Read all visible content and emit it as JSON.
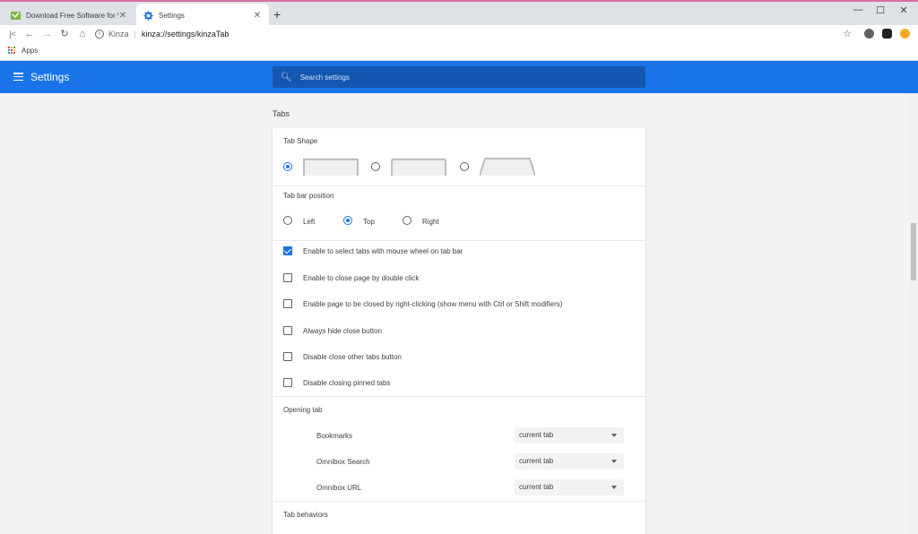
{
  "browser": {
    "tabs": [
      {
        "title": "Download Free Software for Win",
        "active": false
      },
      {
        "title": "Settings",
        "active": true
      }
    ],
    "omnibox": {
      "site": "Kinza",
      "url": "kinza://settings/kinzaTab"
    },
    "bookmarks": {
      "apps_label": "Apps"
    }
  },
  "header": {
    "title": "Settings",
    "search_placeholder": "Search settings"
  },
  "section": {
    "title": "Tabs",
    "tab_shape": {
      "label": "Tab Shape",
      "selected_index": 0
    },
    "tab_bar_position": {
      "label": "Tab bar position",
      "options": [
        "Left",
        "Top",
        "Right"
      ],
      "selected": "Top"
    },
    "checkboxes": [
      {
        "label": "Enable to select tabs with mouse wheel on tab bar",
        "checked": true
      },
      {
        "label": "Enable to close page by double click",
        "checked": false
      },
      {
        "label": "Enable page to be closed by right-clicking (show menu with Ctrl or Shift modifiers)",
        "checked": false
      },
      {
        "label": "Always hide close button",
        "checked": false
      },
      {
        "label": "Disable close other tabs button",
        "checked": false
      },
      {
        "label": "Disable closing pinned tabs",
        "checked": false
      }
    ],
    "opening_tab": {
      "label": "Opening tab",
      "rows": [
        {
          "label": "Bookmarks",
          "value": "current tab"
        },
        {
          "label": "Omnibox Search",
          "value": "current tab"
        },
        {
          "label": "Omnibox URL",
          "value": "current tab"
        }
      ]
    },
    "tab_behaviors": {
      "label": "Tab behaviors"
    }
  },
  "colors": {
    "accent": "#1a73e8",
    "header_bg": "#1a73e8",
    "search_bg": "#1557b0",
    "page_bg": "#f1f3f4"
  }
}
